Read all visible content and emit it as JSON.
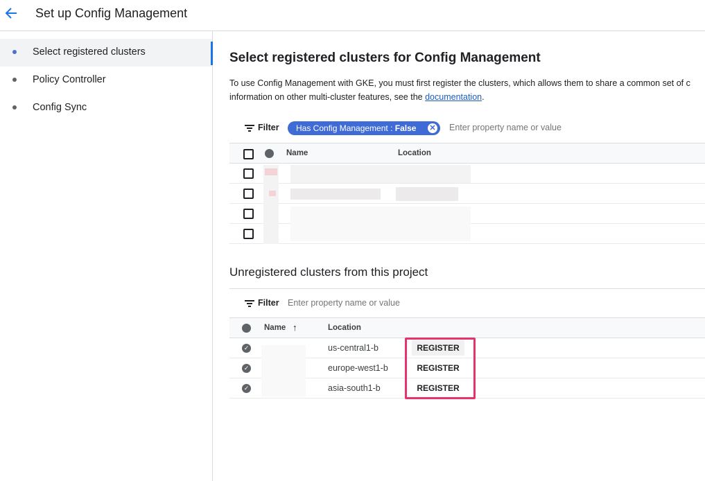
{
  "header": {
    "title": "Set up Config Management",
    "back_icon": "arrow-back-icon"
  },
  "sidebar": {
    "items": [
      {
        "label": "Select registered clusters",
        "active": true
      },
      {
        "label": "Policy Controller",
        "active": false
      },
      {
        "label": "Config Sync",
        "active": false
      }
    ]
  },
  "registered": {
    "heading": "Select registered clusters for Config Management",
    "desc_line1": "To use Config Management with GKE, you must first register the clusters, which allows them to share a common set of c",
    "desc_line2_prefix": "information on other multi-cluster features, see the ",
    "desc_link": "documentation",
    "desc_line2_suffix": ".",
    "filter_label": "Filter",
    "chip_key": "Has Config Management : ",
    "chip_value": "False",
    "filter_placeholder": "Enter property name or value",
    "columns": {
      "name": "Name",
      "location": "Location"
    },
    "row_count": 4
  },
  "unregistered": {
    "heading": "Unregistered clusters from this project",
    "filter_label": "Filter",
    "filter_placeholder": "Enter property name or value",
    "columns": {
      "name": "Name",
      "location": "Location"
    },
    "sort_icon": "arrow-up-icon",
    "rows": [
      {
        "location": "us-central1-b",
        "action": "REGISTER"
      },
      {
        "location": "europe-west1-b",
        "action": "REGISTER"
      },
      {
        "location": "asia-south1-b",
        "action": "REGISTER"
      }
    ]
  },
  "colors": {
    "accent": "#1a73e8",
    "chip": "#3f6bd6",
    "highlight": "#e8336a"
  }
}
